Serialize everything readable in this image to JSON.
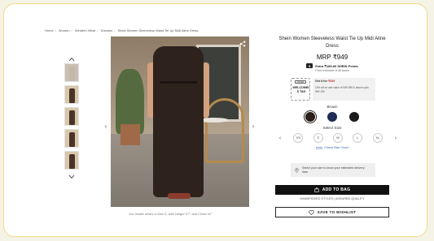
{
  "breadcrumb": [
    "Home",
    "Women",
    "Western Wear",
    "Dresses",
    "Shein Women Sleeveless Waist Tie Up Midi Aline Dress"
  ],
  "product": {
    "title": "Shein Women Sleeveless Waist Tie Up Midi Aline Dress",
    "price": "MRP ₹949",
    "points_badge": "S",
    "points_text": "Extra ₹189.80 SHEIN Points",
    "tax_note": "Price inclusive of all taxes"
  },
  "offer": {
    "coupon_tag": "OFFER",
    "coupon_code": "WELCOMEL S TAG",
    "get_for_label": "Get it for",
    "get_for_amount": "₹949",
    "description": "15% off on cart value of INR 699 & above upto INR 150"
  },
  "color": {
    "label": "Brown",
    "swatches": [
      {
        "name": "brown",
        "hex": "#2b1e17",
        "selected": true
      },
      {
        "name": "navy",
        "hex": "#1f2d57",
        "selected": false
      },
      {
        "name": "black",
        "hex": "#1a1a1a",
        "selected": false
      }
    ]
  },
  "size": {
    "label": "Select Size",
    "options": [
      "XS",
      "S",
      "M",
      "L",
      "XL"
    ],
    "chart_link": "Check Size Chart"
  },
  "delivery": {
    "text": "Select your size to know your estimated delivery date."
  },
  "actions": {
    "add_to_bag": "ADD TO BAG",
    "handpicked": "HANDPICKED STYLES | ASSURED QUALITY",
    "wishlist": "SAVE TO WISHLIST"
  },
  "image": {
    "caption": "Our model wears a Size S, with Height 5'7\" and Chest 32\""
  },
  "icons": [
    "chevron-up-icon",
    "chevron-down-icon",
    "share-icon",
    "chevron-left-icon",
    "chevron-right-icon",
    "ruler-icon",
    "location-icon",
    "bag-icon",
    "heart-icon"
  ],
  "colors": {
    "page_bg": "#f5f2e6",
    "frame_border": "#f0dc82",
    "button_dark": "#111111",
    "link_blue": "#2a66b5"
  }
}
